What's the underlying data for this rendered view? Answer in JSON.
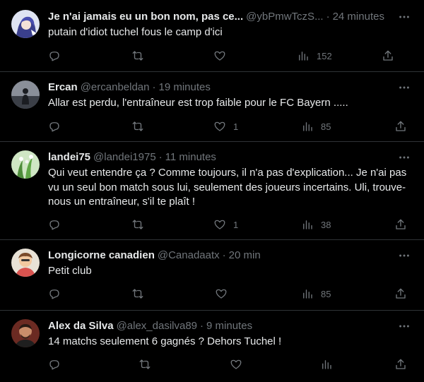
{
  "tweets": [
    {
      "display_name": "Je n'ai jamais eu un bon nom, pas ce...",
      "handle": "@ybPmwTczS...",
      "time": "24 minutes",
      "text": "putain d'idiot tuchel fous le camp d'ici",
      "likes": "",
      "views": "152",
      "avatar": "anime-avatar"
    },
    {
      "display_name": "Ercan",
      "handle": "@ercanbeldan",
      "time": "19 minutes",
      "text": "Allar est perdu, l'entraîneur est trop faible pour le FC Bayern .....",
      "likes": "1",
      "views": "85",
      "avatar": "silhouette-avatar"
    },
    {
      "display_name": "landei75",
      "handle": "@landei1975",
      "time": "11 minutes",
      "text": "Qui veut entendre ça ? Comme toujours, il n'a pas d'explication... Je n'ai pas vu un seul bon match sous lui, seulement des joueurs incertains. Uli, trouve-nous un entraîneur, s'il te plaît !",
      "likes": "1",
      "views": "38",
      "avatar": "plant-avatar"
    },
    {
      "display_name": "Longicorne canadien",
      "handle": "@Canadaatx",
      "time": "20 min",
      "text": "Petit club",
      "likes": "",
      "views": "85",
      "avatar": "cartoon-avatar"
    },
    {
      "display_name": "Alex da Silva",
      "handle": "@alex_dasilva89",
      "time": "9 minutes",
      "text": "14 matchs seulement 6 gagnés ? Dehors Tuchel !",
      "likes": "",
      "views": "",
      "avatar": "photo-avatar"
    }
  ],
  "separator": "·",
  "colors": {
    "background": "#000000",
    "text": "#e7e9ea",
    "secondary": "#71767b",
    "border": "#2f3336"
  }
}
